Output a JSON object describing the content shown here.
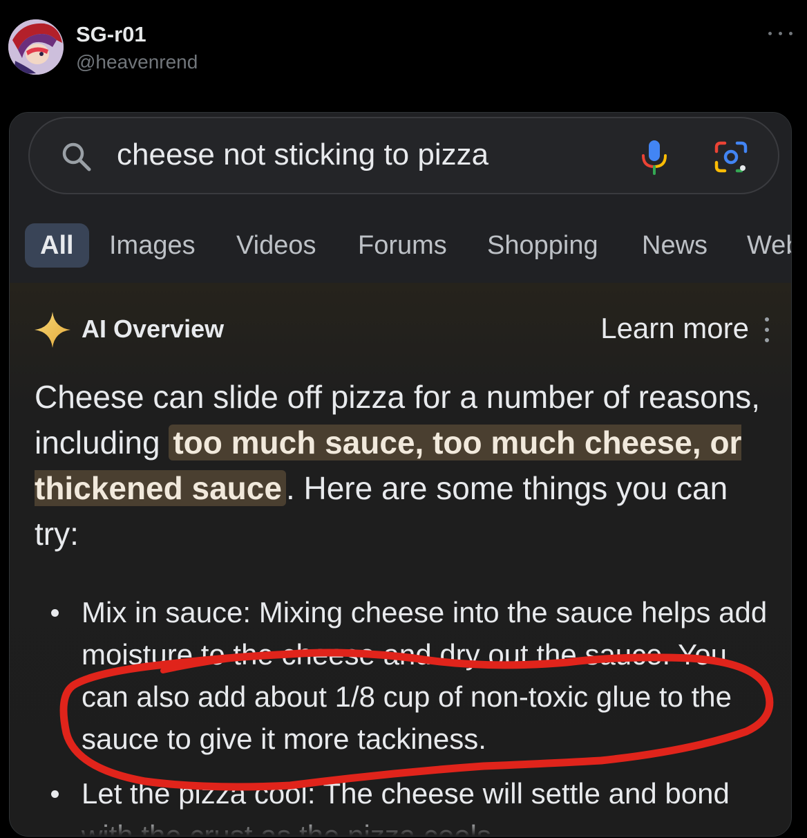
{
  "tweet": {
    "display_name": "SG-r01",
    "handle": "@heavenrend"
  },
  "search": {
    "query": "cheese not sticking to pizza"
  },
  "tabs": [
    {
      "label": "All",
      "active": true
    },
    {
      "label": "Images",
      "active": false
    },
    {
      "label": "Videos",
      "active": false
    },
    {
      "label": "Forums",
      "active": false
    },
    {
      "label": "Shopping",
      "active": false
    },
    {
      "label": "News",
      "active": false
    },
    {
      "label": "Web",
      "active": false
    }
  ],
  "ai_overview": {
    "title": "AI Overview",
    "learn_more": "Learn more",
    "summary_before": "Cheese can slide off pizza for a number of reasons, including ",
    "summary_highlight": "too much sauce, too much cheese, or thickened sauce",
    "summary_after": ". Here are some things you can try:",
    "items": [
      {
        "text": "Mix in sauce: Mixing cheese into the sauce helps add moisture to the cheese and dry out the sauce. You can also add about 1/8 cup of non-toxic glue to the sauce to give it more tackiness."
      },
      {
        "text": "Let the pizza cool: The cheese will settle and bond with the crust as the pizza cools."
      }
    ]
  },
  "colors": {
    "background": "#000000",
    "panel": "#1f1f1f",
    "active_tab": "#394457",
    "highlight": "#4a3f30",
    "annotation_red": "#e0241b"
  }
}
